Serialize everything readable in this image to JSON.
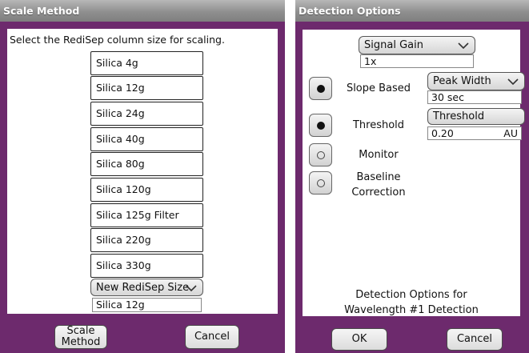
{
  "scale_method": {
    "title": "Scale Method",
    "prompt": "Select the RediSep column size for scaling.",
    "columns": [
      {
        "label": "Silica 4g"
      },
      {
        "label": "Silica 12g"
      },
      {
        "label": "Silica 24g"
      },
      {
        "label": "Silica 40g"
      },
      {
        "label": "Silica 80g"
      },
      {
        "label": "Silica 120g"
      },
      {
        "label": "Silica 125g Filter"
      },
      {
        "label": "Silica 220g"
      },
      {
        "label": "Silica 330g"
      }
    ],
    "new_size_dropdown": "New RediSep Size",
    "selected_size": "Silica 12g",
    "scale_button_line1": "Scale",
    "scale_button_line2": "Method",
    "cancel_button": "Cancel"
  },
  "detection_options": {
    "title": "Detection Options",
    "signal_gain_dropdown": "Signal Gain",
    "signal_gain_value": "1x",
    "slope_based_label": "Slope Based",
    "peak_width_dropdown": "Peak Width",
    "peak_width_value": "30 sec",
    "threshold_label": "Threshold",
    "threshold_button": "Threshold",
    "threshold_value": "0.20",
    "threshold_unit": "AU",
    "monitor_label": "Monitor",
    "baseline_label_line1": "Baseline",
    "baseline_label_line2": "Correction",
    "slope_based_selected": true,
    "threshold_selected": true,
    "monitor_selected": false,
    "baseline_selected": false,
    "footer_line1": "Detection Options for",
    "footer_line2": "Wavelength #1 Detection",
    "ok_button": "OK",
    "cancel_button": "Cancel"
  },
  "colors": {
    "dialog_frame": "#6d2a6d",
    "title_bar": "#9a9a9a"
  }
}
